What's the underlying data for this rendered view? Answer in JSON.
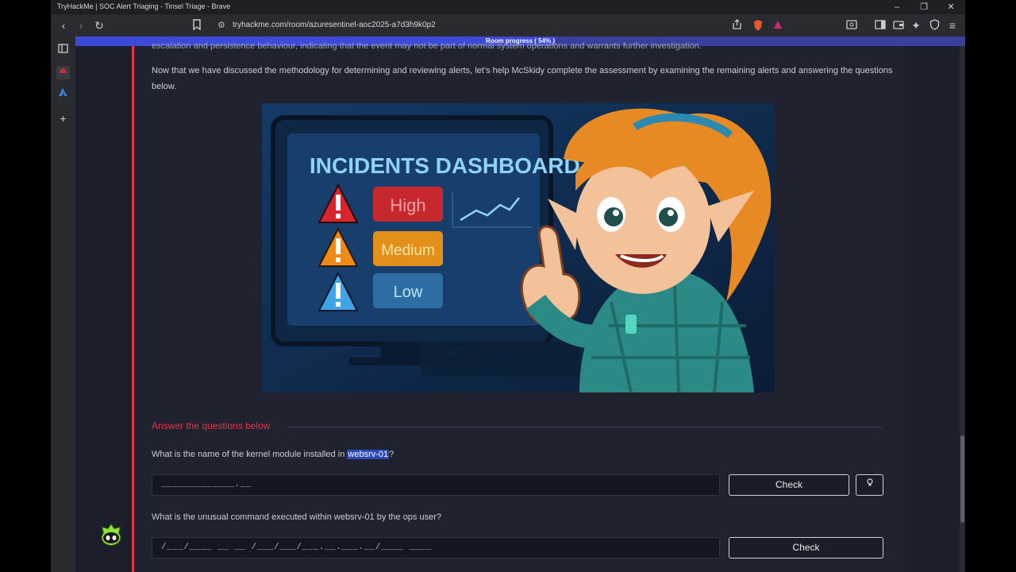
{
  "window": {
    "title": "TryHackMe | SOC Alert Triaging - Tinsel Triage - Brave",
    "minimize": "–",
    "restore": "❐",
    "close": "✕"
  },
  "toolbar": {
    "url": "tryhackme.com/room/azuresentinel-aoc2025-a7d3h9k0p2"
  },
  "progress": {
    "label": "Room progress ( 54% )",
    "percent": 54
  },
  "content": {
    "cut_text": "escalation and persistence behaviour, indicating that the event may not be part of normal system operations and warrants further investigation.",
    "paragraph": "Now that we have discussed the methodology for determining and reviewing alerts, let’s help McSkidy complete the assessment by examining the remaining alerts and answering the questions below.",
    "illustration": {
      "heading": "INCIDENTS DASHBOARD",
      "levels": [
        "High",
        "Medium",
        "Low"
      ]
    },
    "answer_header": "Answer the questions below",
    "questions": [
      {
        "prefix": "What is the name of the kernel module installed in ",
        "highlight": "websrv-01",
        "suffix": "?",
        "input_mask": "_____________.__",
        "check_label": "Check"
      },
      {
        "text": "What is the unusual command executed within websrv-01 by the ops user?",
        "input_mask": "/___/____ __ __ /___/___/___.__.___.__/____ ____",
        "check_label": "Check"
      }
    ]
  },
  "colors": {
    "accent_red": "#e5344c",
    "progress_blue": "#3d4ad8"
  }
}
